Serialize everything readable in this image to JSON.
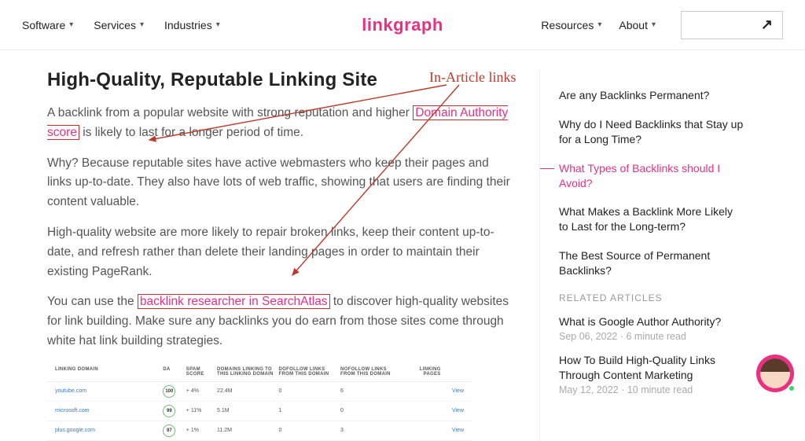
{
  "brand": "linkgraph",
  "nav": {
    "left": [
      "Software",
      "Services",
      "Industries"
    ],
    "right": [
      "Resources",
      "About"
    ]
  },
  "article": {
    "heading": "High-Quality, Reputable Linking Site",
    "p1_a": "A backlink from a popular website with strong reputation and higher ",
    "p1_link": "Domain Authority score",
    "p1_b": " is likely to last for a longer period of time.",
    "p2": "Why? Because reputable sites have active webmasters who keep their pages and links up-to-date. They also have lots of web traffic, showing that users are finding their content valuable.",
    "p3": "High-quality website are more likely to repair broken links, keep their content up-to-date, and refresh rather than delete their landing pages in order to maintain their existing PageRank.",
    "p4_a": "You can use the ",
    "p4_link": "backlink researcher in SearchAtlas",
    "p4_b": " to discover high-quality websites for link building. Make sure any backlinks you do earn from those sites come through white hat link building strategies."
  },
  "table": {
    "headers": {
      "c1": "LINKING DOMAIN",
      "c2": "DA",
      "c3": "SPAM SCORE",
      "c4": "DOMAINS LINKING TO THIS LINKING DOMAIN",
      "c5": "DOFOLLOW LINKS FROM THIS DOMAIN",
      "c6": "NOFOLLOW LINKS FROM THIS DOMAIN",
      "c7": "LINKING PAGES",
      "c8": ""
    },
    "rows": [
      {
        "domain": "youtube.com",
        "da": "100",
        "spam": "+ 4%",
        "dlinking": "22.4M",
        "dofollow": "0",
        "nofollow": "6",
        "pages": "",
        "view": "View"
      },
      {
        "domain": "microsoft.com",
        "da": "99",
        "spam": "+ 11%",
        "dlinking": "5.1M",
        "dofollow": "1",
        "nofollow": "0",
        "pages": "",
        "view": "View"
      },
      {
        "domain": "plus.google.com",
        "da": "97",
        "spam": "+ 1%",
        "dlinking": "11.2M",
        "dofollow": "0",
        "nofollow": "3",
        "pages": "",
        "view": "View"
      }
    ]
  },
  "toc": [
    "Are any Backlinks Permanent?",
    "Why do I Need Backlinks that Stay up for a Long Time?",
    "What Types of Backlinks should I Avoid?",
    "What Makes a Backlink More Likely to Last for the Long-term?",
    "The Best Source of Permanent Backlinks?"
  ],
  "toc_active_index": 2,
  "related_header": "RELATED ARTICLES",
  "related": [
    {
      "title": "What is Google Author Authority?",
      "meta": "Sep 06, 2022 · 6 minute read"
    },
    {
      "title": "How To Build High-Quality Links Through Content Marketing",
      "meta": "May 12, 2022 · 10 minute read"
    }
  ],
  "annotation": {
    "label": "In-Article links"
  }
}
